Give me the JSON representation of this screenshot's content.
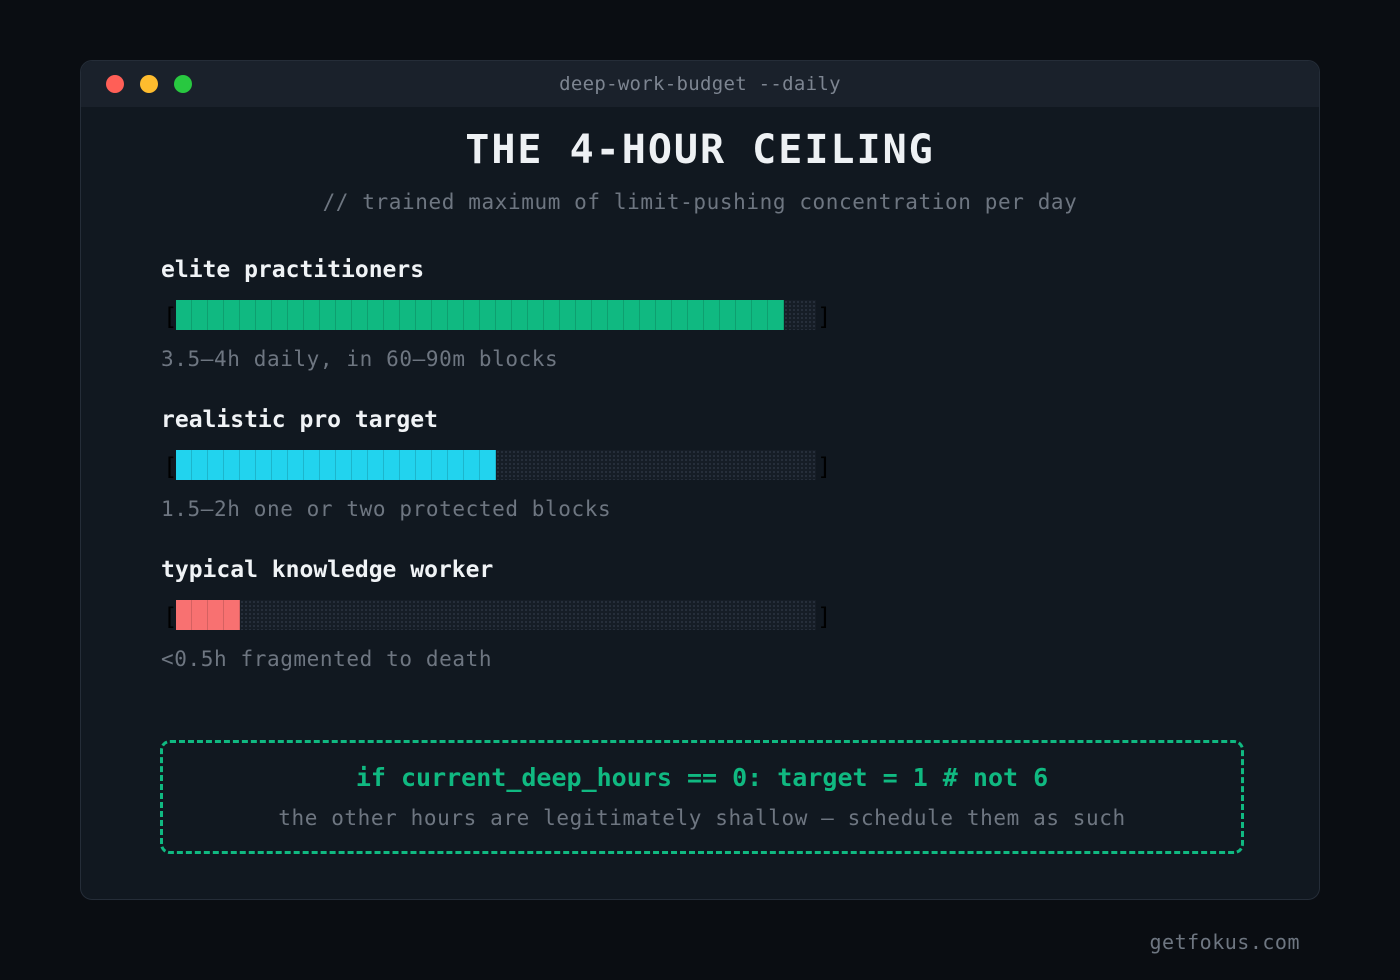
{
  "window": {
    "title": "deep-work-budget --daily",
    "controls": [
      {
        "name": "close",
        "color": "#ff5f57"
      },
      {
        "name": "minimize",
        "color": "#febc2e"
      },
      {
        "name": "maximize",
        "color": "#28c840"
      }
    ]
  },
  "header": {
    "title": "THE 4-HOUR CEILING",
    "subtitle": "// trained maximum of limit-pushing concentration per day"
  },
  "metrics": [
    {
      "label": "elite practitioners",
      "note": "3.5–4h daily, in 60–90m blocks",
      "fill_fraction": 0.95,
      "color": "#10b981"
    },
    {
      "label": "realistic pro target",
      "note": "1.5–2h one or two protected blocks",
      "fill_fraction": 0.5,
      "color": "#22d3ee"
    },
    {
      "label": "typical knowledge worker",
      "note": "<0.5h fragmented to death",
      "fill_fraction": 0.1,
      "color": "#f87171"
    }
  ],
  "callout": {
    "code": "if current_deep_hours == 0: target = 1 # not 6",
    "note": "the other hours are legitimately shallow — schedule them as such"
  },
  "footer": {
    "brand": "getfokus.com"
  }
}
